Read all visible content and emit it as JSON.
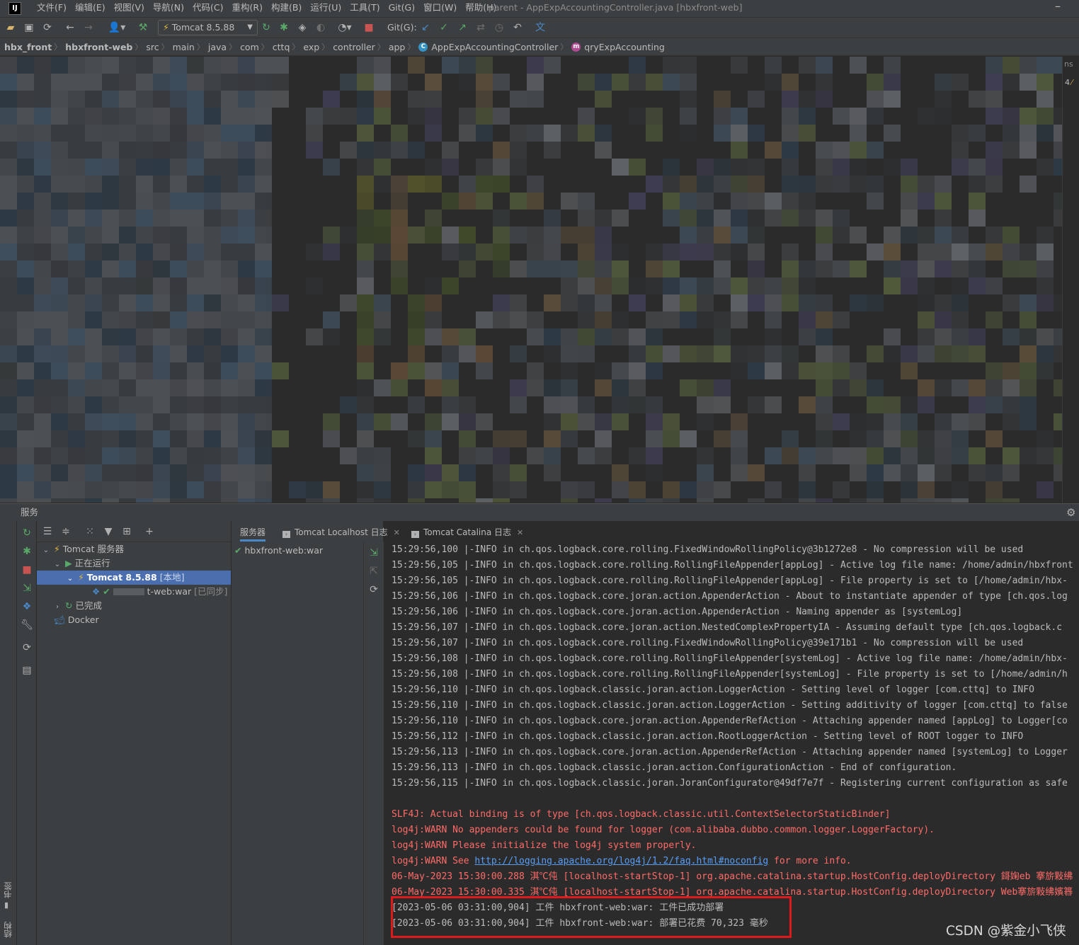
{
  "menubar": {
    "logo": "IJ",
    "items": [
      "文件(F)",
      "编辑(E)",
      "视图(V)",
      "导航(N)",
      "代码(C)",
      "重构(R)",
      "构建(B)",
      "运行(U)",
      "工具(T)",
      "Git(G)",
      "窗口(W)",
      "帮助(H)"
    ],
    "window_title": "parent - AppExpAccountingController.java [hbxfront-web]",
    "minimize": "–"
  },
  "toolbar": {
    "run_config": "Tomcat 8.5.88",
    "git_label": "Git(G):"
  },
  "breadcrumb": {
    "items": [
      "hbx_front",
      "hbxfront-web",
      "src",
      "main",
      "java",
      "com",
      "cttq",
      "exp",
      "controller",
      "app"
    ],
    "class_name": "AppExpAccountingController",
    "class_icon": "C",
    "method_name": "qryExpAccounting",
    "method_icon": "m"
  },
  "editor": {
    "right_markers": [
      "ns",
      "4"
    ]
  },
  "services": {
    "title": "服务",
    "side_labels": [
      "书签",
      "结构"
    ],
    "tree": {
      "tomcat_servers": "Tomcat 服务器",
      "running": "正在运行",
      "tomcat_instance": "Tomcat 8.5.88",
      "tomcat_instance_tag": "[本地]",
      "artifact": "t-web:war",
      "artifact_tag": "[已同步]",
      "finished": "已完成",
      "docker": "Docker"
    },
    "tabs": {
      "server": "服务器",
      "localhost_log": "Tomcat Localhost 日志",
      "catalina_log": "Tomcat Catalina 日志"
    },
    "deployment": "hbxfront-web:war"
  },
  "console": {
    "lines": [
      {
        "text": "15:29:56,100 |-INFO in ch.qos.logback.core.rolling.FixedWindowRollingPolicy@3b1272e8 - No compression will be used",
        "style": "normal"
      },
      {
        "text": "15:29:56,105 |-INFO in ch.qos.logback.core.rolling.RollingFileAppender[appLog] - Active log file name: /home/admin/hbxfront",
        "style": "normal"
      },
      {
        "text": "15:29:56,105 |-INFO in ch.qos.logback.core.rolling.RollingFileAppender[appLog] - File property is set to [/home/admin/hbx-",
        "style": "normal"
      },
      {
        "text": "15:29:56,106 |-INFO in ch.qos.logback.core.joran.action.AppenderAction - About to instantiate appender of type [ch.qos.log",
        "style": "normal"
      },
      {
        "text": "15:29:56,106 |-INFO in ch.qos.logback.core.joran.action.AppenderAction - Naming appender as [systemLog]",
        "style": "normal"
      },
      {
        "text": "15:29:56,107 |-INFO in ch.qos.logback.core.joran.action.NestedComplexPropertyIA - Assuming default type [ch.qos.logback.c",
        "style": "normal"
      },
      {
        "text": "15:29:56,107 |-INFO in ch.qos.logback.core.rolling.FixedWindowRollingPolicy@39e171b1 - No compression will be used",
        "style": "normal"
      },
      {
        "text": "15:29:56,108 |-INFO in ch.qos.logback.core.rolling.RollingFileAppender[systemLog] - Active log file name: /home/admin/hbx-",
        "style": "normal"
      },
      {
        "text": "15:29:56,108 |-INFO in ch.qos.logback.core.rolling.RollingFileAppender[systemLog] - File property is set to [/home/admin/h",
        "style": "normal"
      },
      {
        "text": "15:29:56,110 |-INFO in ch.qos.logback.classic.joran.action.LoggerAction - Setting level of logger [com.cttq] to INFO",
        "style": "normal"
      },
      {
        "text": "15:29:56,110 |-INFO in ch.qos.logback.classic.joran.action.LoggerAction - Setting additivity of logger [com.cttq] to false",
        "style": "normal"
      },
      {
        "text": "15:29:56,110 |-INFO in ch.qos.logback.core.joran.action.AppenderRefAction - Attaching appender named [appLog] to Logger[co",
        "style": "normal"
      },
      {
        "text": "15:29:56,112 |-INFO in ch.qos.logback.classic.joran.action.RootLoggerAction - Setting level of ROOT logger to INFO",
        "style": "normal"
      },
      {
        "text": "15:29:56,113 |-INFO in ch.qos.logback.core.joran.action.AppenderRefAction - Attaching appender named [systemLog] to Logger",
        "style": "normal"
      },
      {
        "text": "15:29:56,113 |-INFO in ch.qos.logback.classic.joran.action.ConfigurationAction - End of configuration.",
        "style": "normal"
      },
      {
        "text": "15:29:56,115 |-INFO in ch.qos.logback.classic.joran.JoranConfigurator@49df7e7f - Registering current configuration as safe",
        "style": "normal"
      },
      {
        "text": "",
        "style": "normal"
      },
      {
        "text": "SLF4J: Actual binding is of type [ch.qos.logback.classic.util.ContextSelectorStaticBinder]",
        "style": "red"
      },
      {
        "text": "log4j:WARN No appenders could be found for logger (com.alibaba.dubbo.common.logger.LoggerFactory).",
        "style": "red"
      },
      {
        "text": "log4j:WARN Please initialize the log4j system properly.",
        "style": "red"
      },
      {
        "text": "log4j:WARN See ",
        "link": "http://logging.apache.org/log4j/1.2/faq.html#noconfig",
        "suffix": " for more info.",
        "style": "red"
      },
      {
        "text": "06-May-2023 15:30:00.288 淇℃伅 [localhost-startStop-1] org.apache.catalina.startup.HostConfig.deployDirectory 鎶婅eb 搴旂敤绋",
        "style": "red"
      },
      {
        "text": "06-May-2023 15:30:00.335 淇℃伅 [localhost-startStop-1] org.apache.catalina.startup.HostConfig.deployDirectory Web搴旂敤绋嬪簭",
        "style": "red"
      },
      {
        "text": "[2023-05-06 03:31:00,904] 工件 hbxfront-web:war: 工件已成功部署",
        "style": "normal"
      },
      {
        "text": "[2023-05-06 03:31:00,904] 工件 hbxfront-web:war: 部署已花费 70,323 毫秒",
        "style": "normal"
      }
    ]
  },
  "watermark": "CSDN @紫金小飞侠",
  "colors": {
    "background": "#2b2b2b",
    "panel": "#3c3f41",
    "selection": "#4b6eaf",
    "error_text": "#ff6b68",
    "link": "#589df6",
    "highlight_border": "#e0191d",
    "run_green": "#59a869",
    "stop_red": "#c75450"
  }
}
